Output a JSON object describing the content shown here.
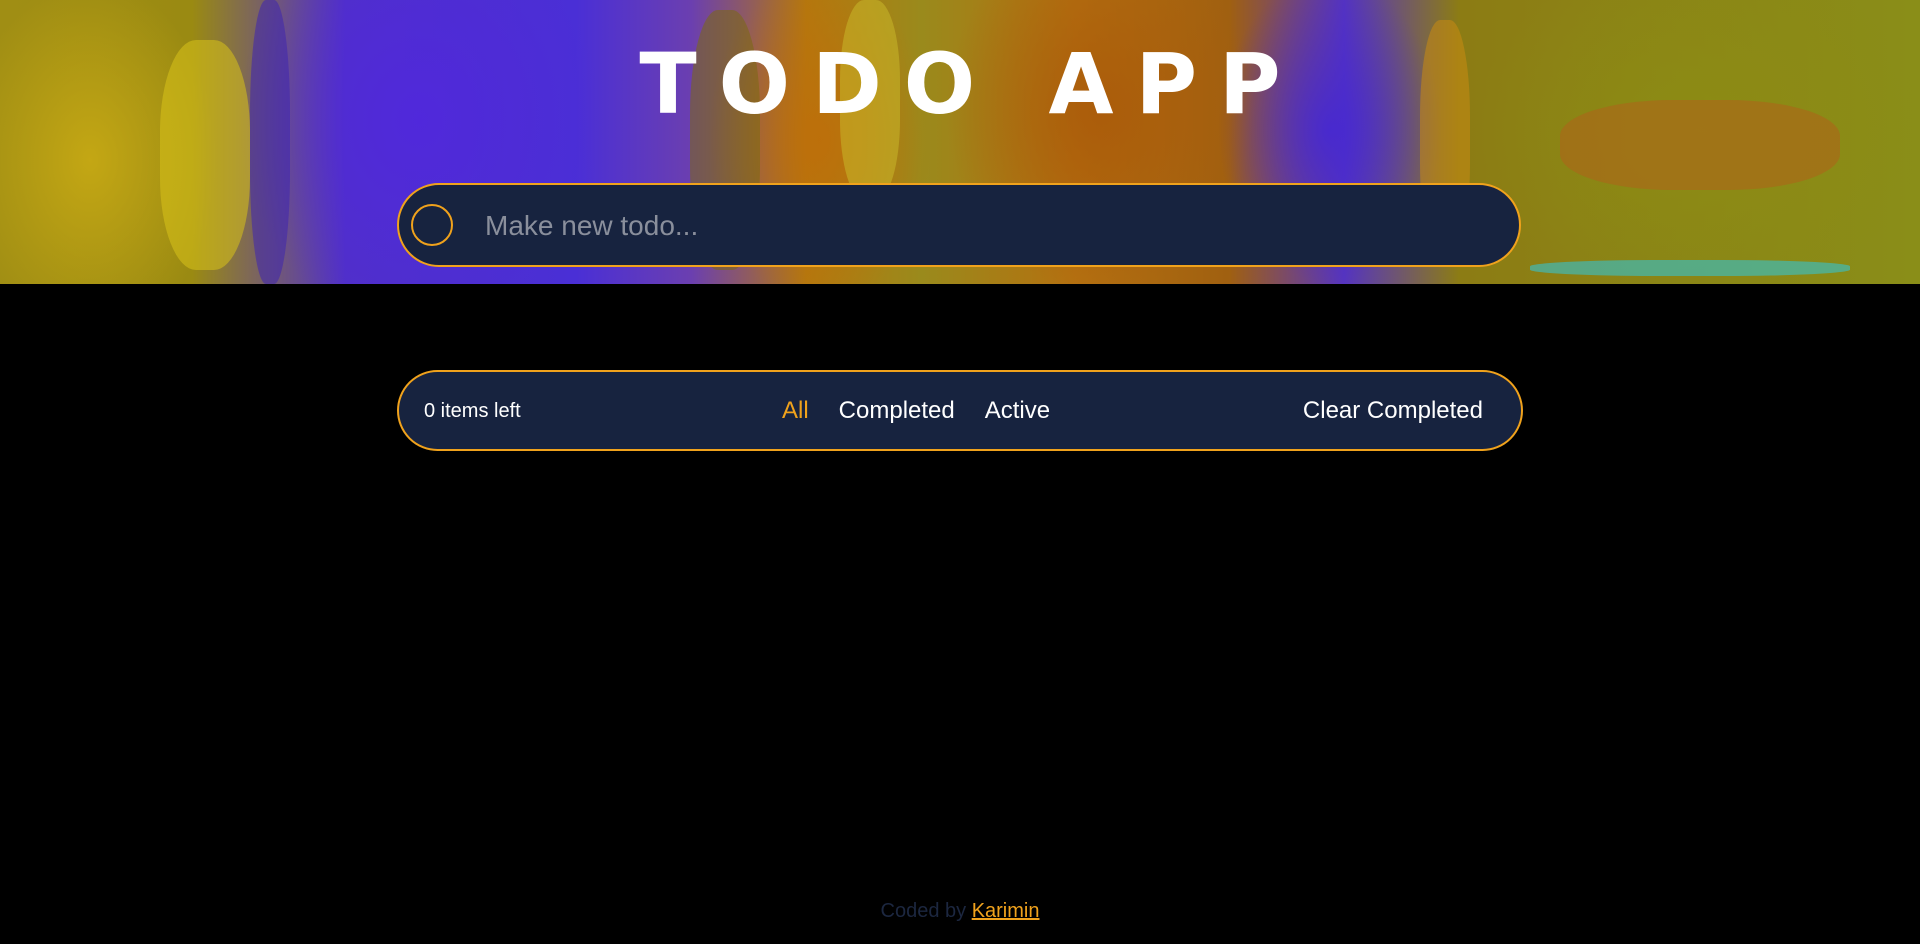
{
  "header": {
    "title": "TODO APP"
  },
  "new_todo": {
    "placeholder": "Make new todo..."
  },
  "footer_bar": {
    "items_left": "0 items left",
    "filters": [
      {
        "label": "All",
        "active": true
      },
      {
        "label": "Completed",
        "active": false
      },
      {
        "label": "Active",
        "active": false
      }
    ],
    "clear_label": "Clear Completed"
  },
  "credit": {
    "prefix": "Coded by",
    "author": "Karimin"
  },
  "colors": {
    "accent": "#f0a21c",
    "panel": "#17233f",
    "background": "#000000",
    "credit_text": "#1c2740"
  }
}
